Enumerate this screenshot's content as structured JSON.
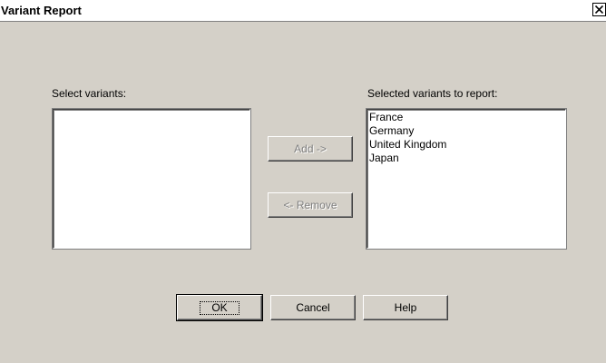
{
  "window": {
    "title": "Variant Report",
    "close_icon": "close-icon"
  },
  "left_panel": {
    "label": "Select variants:",
    "items": []
  },
  "right_panel": {
    "label": "Selected variants to report:",
    "items": [
      "France",
      "Germany",
      "United Kingdom",
      "Japan"
    ]
  },
  "transfer_buttons": {
    "add_label": "Add ->",
    "remove_label": "<- Remove",
    "add_enabled": false,
    "remove_enabled": false
  },
  "footer_buttons": {
    "ok_label": "OK",
    "cancel_label": "Cancel",
    "help_label": "Help"
  },
  "colors": {
    "dialog_face": "#d4d0c8",
    "disabled_text": "#808080"
  }
}
